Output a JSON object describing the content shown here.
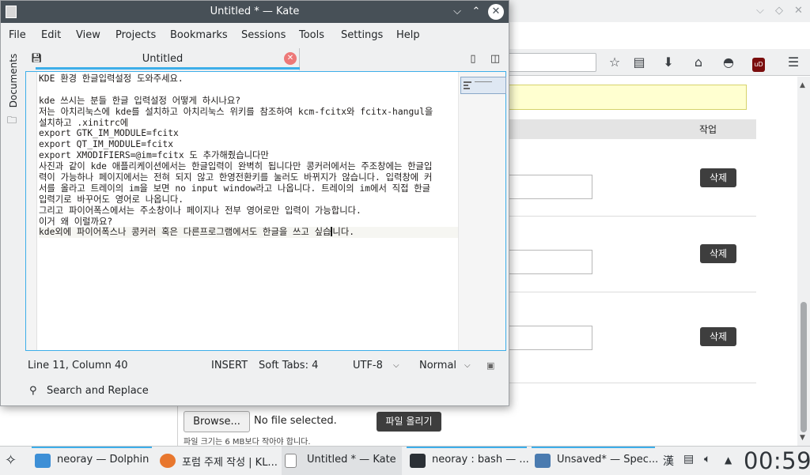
{
  "kate": {
    "title": "Untitled * — Kate",
    "menu": [
      "File",
      "Edit",
      "View",
      "Projects",
      "Bookmarks",
      "Sessions",
      "Tools",
      "Settings",
      "Help"
    ],
    "sidebar_label": "Documents",
    "tab_label": "Untitled",
    "lines": [
      "KDE 환경 한글입력설정 도와주세요.",
      "",
      "kde 쓰시는 분들 한글 입력설정 어떻게 하시나요?",
      "저는 아치리눅스에 kde를 설치하고 아치리눅스 위키를 참조하여 kcm-fcitx와 fcitx-hangul을",
      "설치하고 .xinitrc에",
      "export GTK_IM_MODULE=fcitx",
      "export QT_IM_MODULE=fcitx",
      "export XMODIFIERS=@im=fcitx 도 추가해줬습니다만",
      "사진과 같이 kde 애플리케이션에서는 한글입력이 완벽히 됩니다만 콩커러에서는 주조창에는 한글입",
      "력이 가능하나 페이지에서는 전혀 되지 않고 한영전환키를 눌러도 바뀌지가 않습니다. 입력창에 커",
      "서를 올라고 트레이의 im을 보면 no input window라고 나옵니다. 트레이의 im에서 직접 한글",
      "입력기로 바꾸어도 영어로 나옵니다.",
      "그리고 파이어폭스에서는 주소창이나 페이지나 전부 영어로만 입력이 가능합니다.",
      "이거 왜 이럴까요?"
    ],
    "current_line_before_caret": "kde외에 파이어폭스나 콩커러 혹은 다른프로그램에서도 한글을 쓰고 싶습",
    "current_line_after_caret": "니다.",
    "status": {
      "position": "Line 11, Column 40",
      "mode": "INSERT",
      "tabs": "Soft Tabs: 4",
      "encoding": "UTF-8",
      "highlight": "Normal"
    },
    "search_label": "Search and Replace"
  },
  "firefox": {
    "table_header_action": "작업",
    "delete_label": "삭제",
    "browse_label": "Browse...",
    "no_file_label": "No file selected.",
    "upload_label": "파일 올리기",
    "size_note": "파일 크기는 6 MB보다 작아야 합니다."
  },
  "taskbar": {
    "tasks": [
      {
        "label": "neoray — Dolphin",
        "icon_color": "#3d8fd6"
      },
      {
        "label": "포럼 주제 작성 | KL...",
        "icon_color": "#e8772e"
      },
      {
        "label": "Untitled * — Kate",
        "icon_color": "#ffffff"
      },
      {
        "label": "neoray : bash — ...",
        "icon_color": "#2b3036"
      },
      {
        "label": "Unsaved* — Spec...",
        "icon_color": "#4a7bb0"
      }
    ],
    "clock": "00:59"
  },
  "colors": {
    "accent": "#3daee9",
    "titlebar": "#475057",
    "dark_button": "#3e3e3e"
  }
}
